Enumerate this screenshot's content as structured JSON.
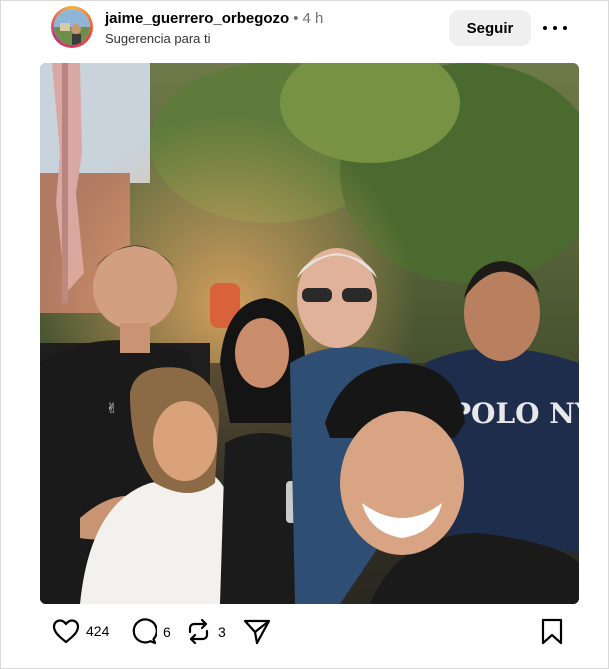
{
  "post": {
    "username": "jaime_guerrero_orbegozo",
    "separator": "•",
    "time": "4 h",
    "subtitle": "Sugerencia para ti",
    "follow_label": "Seguir"
  },
  "photo": {
    "shirt_text": "POLO NYC"
  },
  "actions": {
    "likes": "424",
    "comments": "6",
    "reposts": "3"
  },
  "colors": {
    "follow_bg": "#efefef",
    "secondary_text": "#737373"
  },
  "icons": [
    "heart-icon",
    "comment-icon",
    "repost-icon",
    "share-icon",
    "bookmark-icon",
    "more-options-icon"
  ]
}
